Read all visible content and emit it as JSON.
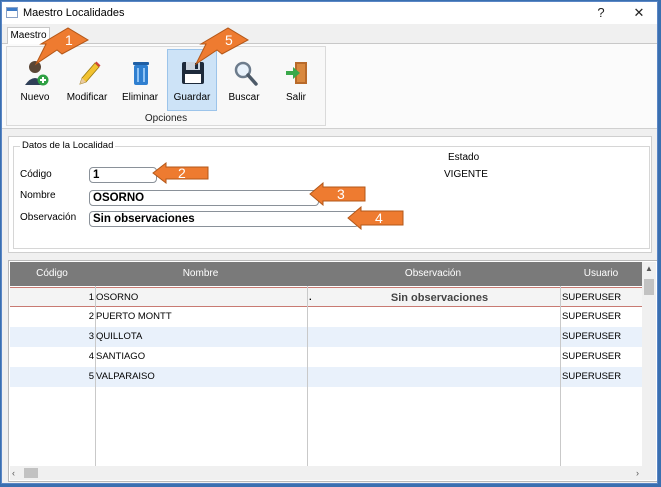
{
  "window": {
    "title": "Maestro Localidades",
    "help": "?",
    "close": "✕"
  },
  "tabs": [
    {
      "label": "Maestro"
    }
  ],
  "ribbon": {
    "group_label": "Opciones",
    "buttons": [
      {
        "label": "Nuevo",
        "icon": "new-user-icon"
      },
      {
        "label": "Modificar",
        "icon": "pencil-icon"
      },
      {
        "label": "Eliminar",
        "icon": "trash-can-icon"
      },
      {
        "label": "Guardar",
        "icon": "floppy-disk-icon"
      },
      {
        "label": "Buscar",
        "icon": "magnifier-icon"
      },
      {
        "label": "Salir",
        "icon": "exit-door-icon"
      }
    ]
  },
  "form": {
    "legend": "Datos de la Localidad",
    "codigo_label": "Código",
    "codigo_value": "1",
    "nombre_label": "Nombre",
    "nombre_value": "OSORNO",
    "observacion_label": "Observación",
    "observacion_value": "Sin observaciones",
    "estado_label": "Estado",
    "estado_value": "VIGENTE"
  },
  "grid": {
    "columns": [
      "Código",
      "Nombre",
      "Observación",
      "Usuario"
    ],
    "rows": [
      {
        "codigo": "1",
        "nombre": "OSORNO",
        "observacion": "Sin observaciones",
        "usuario": "SUPERUSER",
        "selected": true
      },
      {
        "codigo": "2",
        "nombre": "PUERTO MONTT",
        "observacion": "",
        "usuario": "SUPERUSER"
      },
      {
        "codigo": "3",
        "nombre": "QUILLOTA",
        "observacion": "",
        "usuario": "SUPERUSER"
      },
      {
        "codigo": "4",
        "nombre": "SANTIAGO",
        "observacion": "",
        "usuario": "SUPERUSER"
      },
      {
        "codigo": "5",
        "nombre": "VALPARAISO",
        "observacion": "",
        "usuario": "SUPERUSER"
      }
    ],
    "selected_observacion_prefix": "."
  },
  "annotations": [
    "1",
    "2",
    "3",
    "4",
    "5"
  ],
  "colors": {
    "accent": "#ee7b30",
    "selected_row": "#f4f4f4",
    "alt_row": "#e9f1fb",
    "header": "#7a7a7a",
    "window_border": "#3a6fb0"
  }
}
